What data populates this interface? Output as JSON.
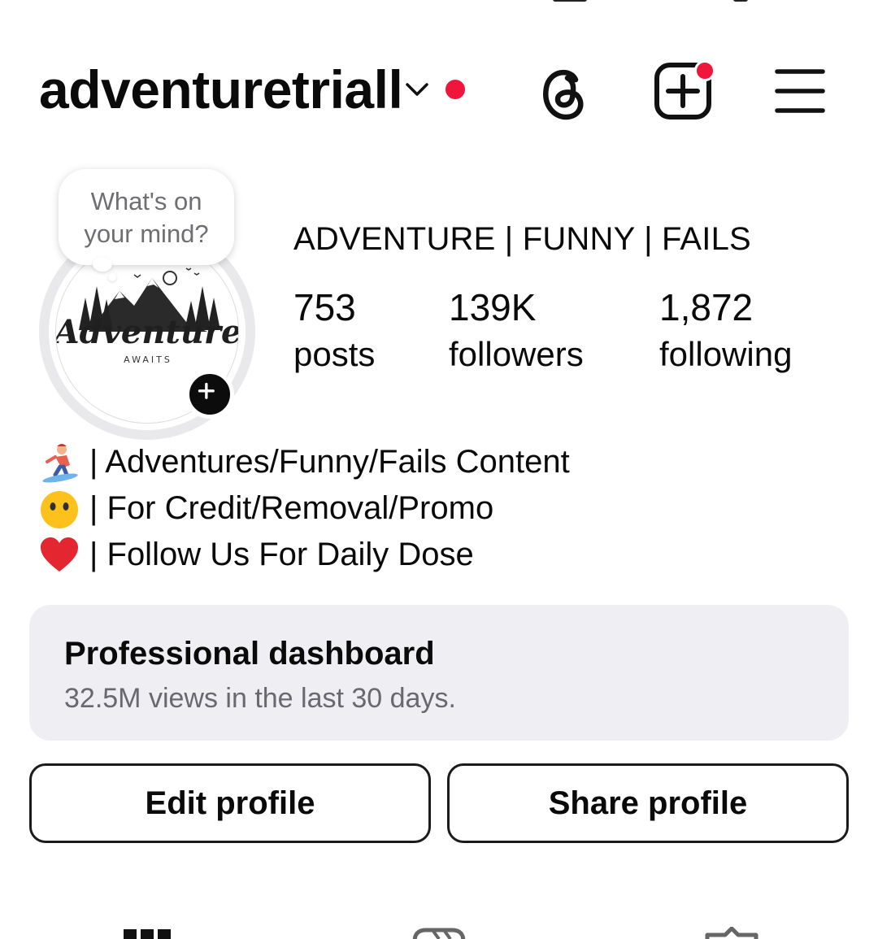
{
  "header": {
    "username": "adventuretriall",
    "notification_color": "#f0163b",
    "icons": [
      "chevron-down-icon",
      "threads-icon",
      "add-post-icon",
      "menu-icon"
    ]
  },
  "note": {
    "line1": "What's on",
    "line2": "your mind?"
  },
  "profile": {
    "display_name": "ADVENTURE | FUNNY | FAILS",
    "stats": [
      {
        "value": "753",
        "label": "posts"
      },
      {
        "value": "139K",
        "label": "followers"
      },
      {
        "value": "1,872",
        "label": "following"
      }
    ]
  },
  "bio": [
    {
      "emoji": "snowboarder-emoji",
      "text": "| Adventures/Funny/Fails Content"
    },
    {
      "emoji": "no-mouth-face-emoji",
      "text": "| For Credit/Removal/Promo"
    },
    {
      "emoji": "red-heart-emoji",
      "text": "| Follow Us For Daily Dose"
    }
  ],
  "dashboard": {
    "title": "Professional dashboard",
    "subtitle": "32.5M views in the last 30 days."
  },
  "actions": {
    "edit_label": "Edit profile",
    "share_label": "Share profile"
  },
  "tabs": [
    "grid-icon",
    "reels-icon",
    "tagged-icon"
  ]
}
